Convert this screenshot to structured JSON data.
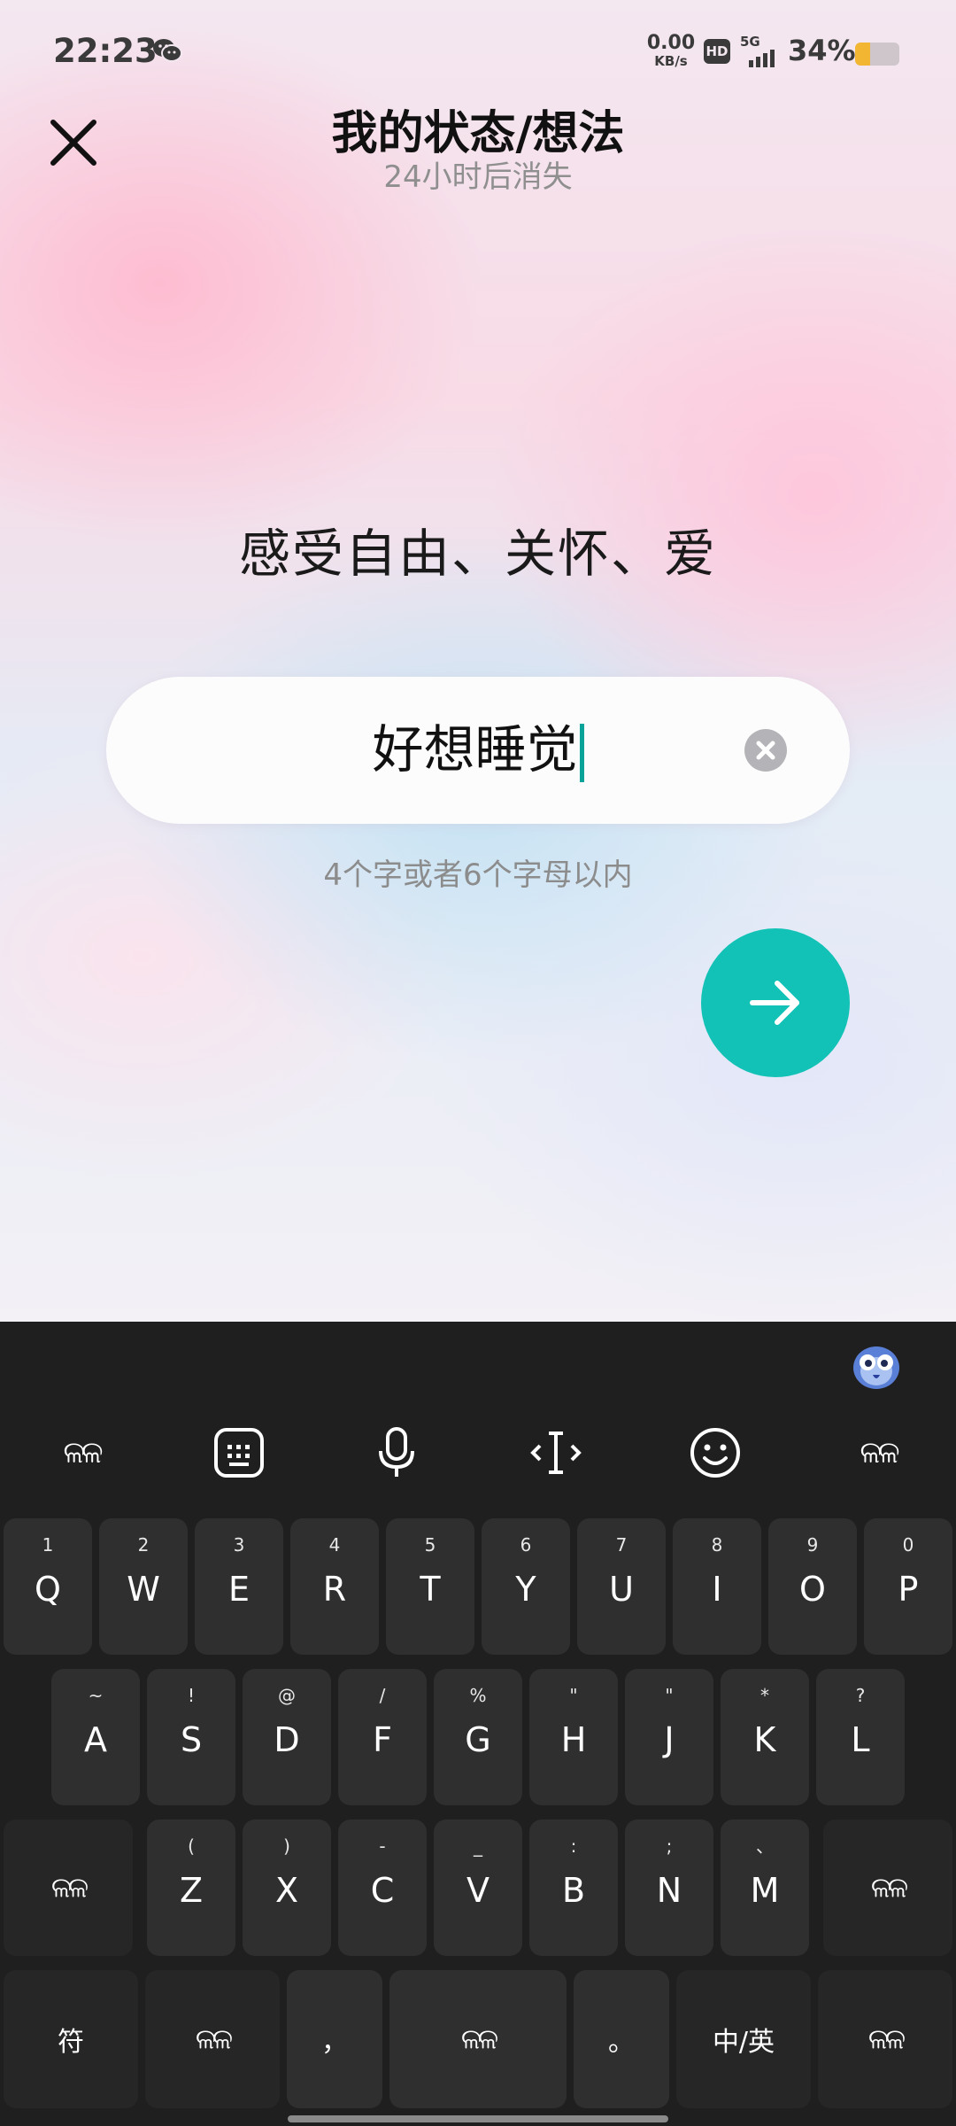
{
  "status_bar": {
    "time": "22:23",
    "net_speed_value": "0.00",
    "net_speed_unit": "KB/s",
    "hd_badge": "HD",
    "network": "5G",
    "battery_percent": "34%",
    "battery_level": 0.34,
    "battery_color": "#f2b632"
  },
  "header": {
    "title": "我的状态/想法",
    "subtitle": "24小时后消失"
  },
  "main": {
    "quote": "感受自由、关怀、爱",
    "input_value": "好想睡觉",
    "hint": "4个字或者6个字母以内",
    "accent_color": "#13c2b6"
  },
  "keyboard": {
    "toolbar": [
      "angel-wings-icon",
      "keyboard-icon",
      "microphone-icon",
      "text-cursor-icon",
      "emoji-icon",
      "angel-wings-icon"
    ],
    "wings_glyph": "ଳଳ",
    "row1": [
      {
        "alt": "1",
        "key": "Q"
      },
      {
        "alt": "2",
        "key": "W"
      },
      {
        "alt": "3",
        "key": "E"
      },
      {
        "alt": "4",
        "key": "R"
      },
      {
        "alt": "5",
        "key": "T"
      },
      {
        "alt": "6",
        "key": "Y"
      },
      {
        "alt": "7",
        "key": "U"
      },
      {
        "alt": "8",
        "key": "I"
      },
      {
        "alt": "9",
        "key": "O"
      },
      {
        "alt": "0",
        "key": "P"
      }
    ],
    "row2": [
      {
        "alt": "~",
        "key": "A"
      },
      {
        "alt": "!",
        "key": "S"
      },
      {
        "alt": "@",
        "key": "D"
      },
      {
        "alt": "/",
        "key": "F"
      },
      {
        "alt": "%",
        "key": "G"
      },
      {
        "alt": "\"",
        "key": "H"
      },
      {
        "alt": "\"",
        "key": "J"
      },
      {
        "alt": "*",
        "key": "K"
      },
      {
        "alt": "?",
        "key": "L"
      }
    ],
    "row3": [
      {
        "alt": "(",
        "key": "Z"
      },
      {
        "alt": ")",
        "key": "X"
      },
      {
        "alt": "-",
        "key": "C"
      },
      {
        "alt": "_",
        "key": "V"
      },
      {
        "alt": ":",
        "key": "B"
      },
      {
        "alt": ";",
        "key": "N"
      },
      {
        "alt": "、",
        "key": "M"
      }
    ],
    "bottom": {
      "symbols": "符",
      "comma": "，",
      "period": "。",
      "lang": "中/英"
    }
  }
}
